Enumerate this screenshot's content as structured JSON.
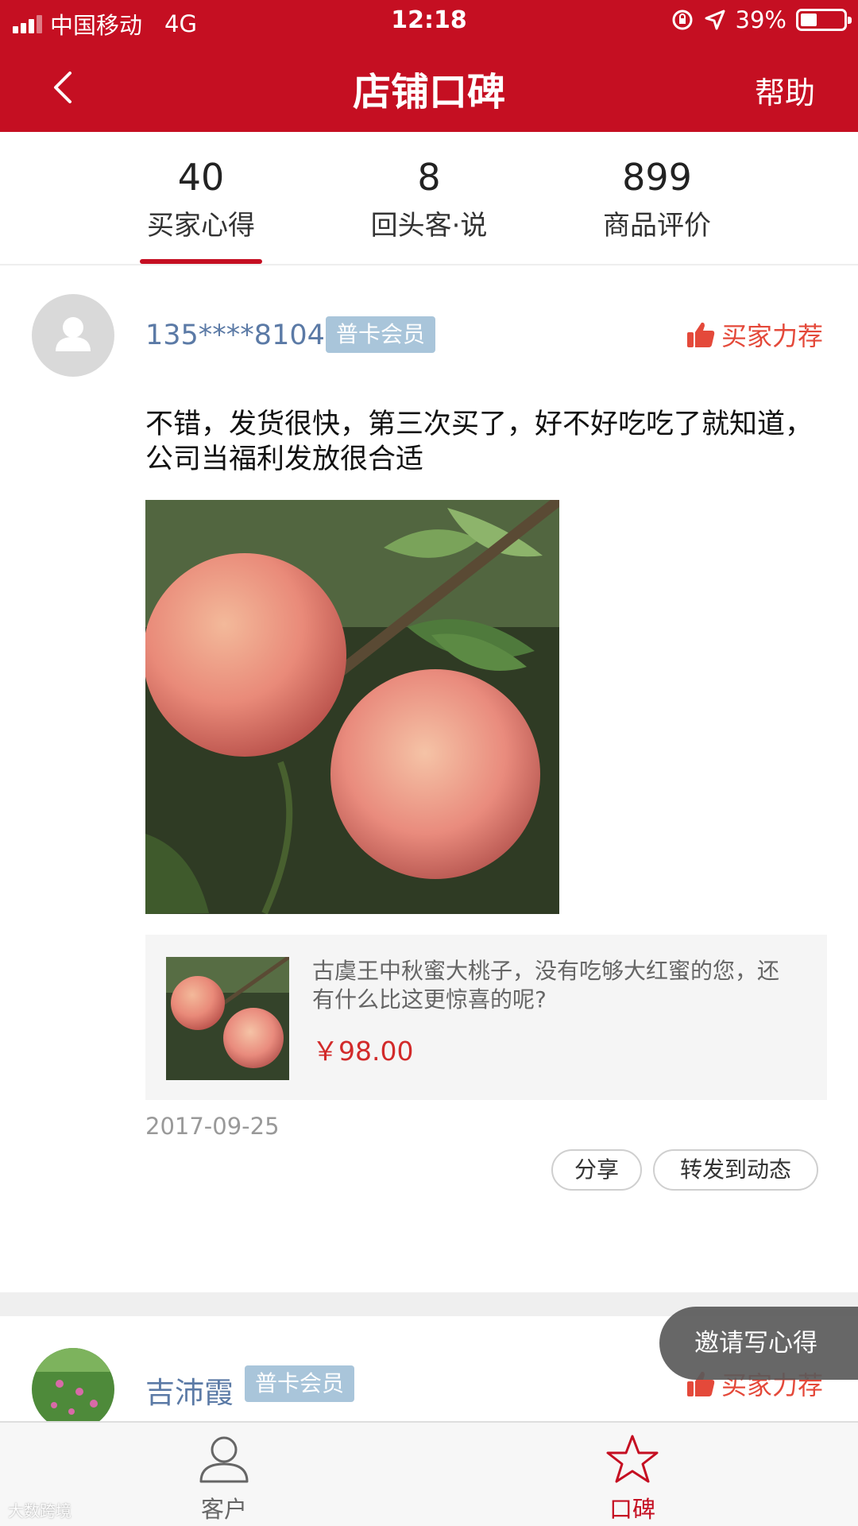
{
  "status_bar": {
    "carrier": "中国移动",
    "network": "4G",
    "time": "12:18",
    "battery": "39%",
    "battery_level": 0.39
  },
  "nav": {
    "title": "店铺口碑",
    "help": "帮助"
  },
  "tabs": [
    {
      "count": "40",
      "label": "买家心得"
    },
    {
      "count": "8",
      "label": "回头客·说"
    },
    {
      "count": "899",
      "label": "商品评价"
    }
  ],
  "post": {
    "username": "135****8104",
    "badge": "普卡会员",
    "recommend": "买家力荐",
    "text": "不错，发货很快，第三次买了，好不好吃吃了就知道，公司当福利发放很合适",
    "product_name": "古虞王中秋蜜大桃子，没有吃够大红蜜的您，还有什么比这更惊喜的呢?",
    "product_price": "￥98.00",
    "date": "2017-09-25",
    "share": "分享",
    "forward": "转发到动态"
  },
  "post2": {
    "username": "吉沛霞",
    "badge": "普卡会员",
    "recommend": "买家力荐"
  },
  "invite_button": "邀请写心得",
  "tabbar": {
    "customers": "客户",
    "reputation": "口碑"
  },
  "watermark": "大数跨境",
  "colors": {
    "brand_red": "#c50f22",
    "link_blue": "#5b7aa6",
    "recommend_orange": "#e4493a"
  }
}
